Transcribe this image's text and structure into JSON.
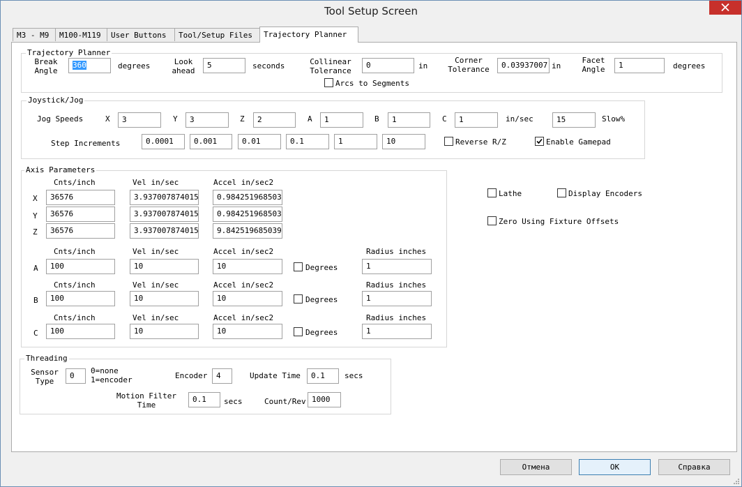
{
  "window": {
    "title": "Tool Setup Screen"
  },
  "tabs": [
    {
      "label": "M3 - M9",
      "active": false
    },
    {
      "label": "M100-M119",
      "active": false
    },
    {
      "label": "User Buttons",
      "active": false
    },
    {
      "label": "Tool/Setup Files",
      "active": false
    },
    {
      "label": "Trajectory Planner",
      "active": true
    }
  ],
  "trajectory": {
    "title": "Trajectory Planner",
    "break_angle_label": "Break\nAngle",
    "break_angle_value": "360",
    "break_angle_unit": "degrees",
    "look_ahead_label": "Look\nahead",
    "look_ahead_value": "5",
    "look_ahead_unit": "seconds",
    "collinear_label": "Collinear\nTolerance",
    "collinear_value": "0",
    "collinear_unit": "in",
    "corner_label": "Corner\nTolerance",
    "corner_value": "0.03937007",
    "corner_unit": "in",
    "facet_label": "Facet\nAngle",
    "facet_value": "1",
    "facet_unit": "degrees",
    "arcs_label": "Arcs to Segments",
    "arcs_checked": false
  },
  "jog": {
    "title": "Joystick/Jog",
    "speeds_label": "Jog Speeds",
    "axis_labels": [
      "X",
      "Y",
      "Z",
      "A",
      "B",
      "C"
    ],
    "speeds": [
      "3",
      "3",
      "2",
      "1",
      "1",
      "1"
    ],
    "speed_unit": "in/sec",
    "slow_value": "15",
    "slow_label": "Slow%",
    "step_label": "Step Increments",
    "steps": [
      "0.0001",
      "0.001",
      "0.01",
      "0.1",
      "1",
      "10"
    ],
    "reverse_label": "Reverse R/Z",
    "reverse_checked": false,
    "gamepad_label": "Enable Gamepad",
    "gamepad_checked": true
  },
  "axis": {
    "title": "Axis Parameters",
    "cnts_header": "Cnts/inch",
    "vel_header": "Vel in/sec",
    "accel_header": "Accel in/sec2",
    "radius_header": "Radius inches",
    "degrees_label": "Degrees",
    "linear": [
      {
        "axis": "X",
        "cnts": "36576",
        "vel": "3.937007874015",
        "accel": "0.984251968503"
      },
      {
        "axis": "Y",
        "cnts": "36576",
        "vel": "3.937007874015",
        "accel": "0.984251968503"
      },
      {
        "axis": "Z",
        "cnts": "36576",
        "vel": "3.937007874015",
        "accel": "9.842519685039"
      }
    ],
    "rotary": [
      {
        "axis": "A",
        "cnts": "100",
        "vel": "10",
        "accel": "10",
        "degrees": false,
        "radius": "1"
      },
      {
        "axis": "B",
        "cnts": "100",
        "vel": "10",
        "accel": "10",
        "degrees": false,
        "radius": "1"
      },
      {
        "axis": "C",
        "cnts": "100",
        "vel": "10",
        "accel": "10",
        "degrees": false,
        "radius": "1"
      }
    ]
  },
  "options": {
    "lathe_label": "Lathe",
    "lathe_checked": false,
    "display_encoders_label": "Display Encoders",
    "display_encoders_checked": false,
    "zero_fixture_label": "Zero Using Fixture Offsets",
    "zero_fixture_checked": false
  },
  "threading": {
    "title": "Threading",
    "sensor_label": "Sensor\nType",
    "sensor_value": "0",
    "sensor_hint": "0=none\n1=encoder",
    "encoder_label": "Encoder",
    "encoder_value": "4",
    "update_label": "Update Time",
    "update_value": "0.1",
    "update_unit": "secs",
    "motion_label": "Motion Filter\nTime",
    "motion_value": "0.1",
    "motion_unit": "secs",
    "count_label": "Count/Rev",
    "count_value": "1000"
  },
  "buttons": {
    "cancel": "Отмена",
    "ok": "OK",
    "help": "Справка"
  },
  "colors": {
    "selection": "#3399ff",
    "close": "#c7302b",
    "default_button": "#3c7fb1"
  }
}
